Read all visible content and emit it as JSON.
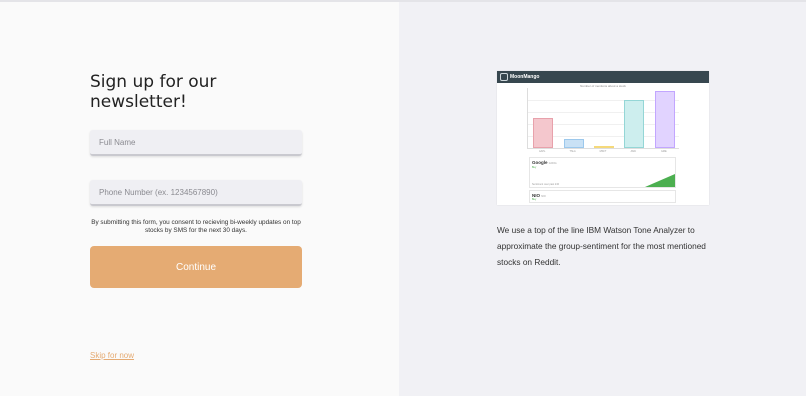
{
  "signup": {
    "title": "Sign up for our newsletter!",
    "full_name_placeholder": "Full Name",
    "phone_placeholder": "Phone Number (ex. 1234567890)",
    "consent": "By submitting this form, you consent to recieving bi-weekly updates on top stocks by SMS for the next 30 days.",
    "continue_label": "Continue",
    "skip_label": "Skip for now"
  },
  "preview": {
    "brand": "MoonMango",
    "chart_title": "Number of mentions about a stock",
    "bars": [
      {
        "label": "AAPL",
        "value": 50,
        "color": "#f4c7cd",
        "border": "#e8a1ab"
      },
      {
        "label": "TSLA",
        "value": 15,
        "color": "#c9e1f5",
        "border": "#9cc8ec"
      },
      {
        "label": "MSFT",
        "value": 2,
        "color": "#fff2c4",
        "border": "#f5d97a"
      },
      {
        "label": "AMC",
        "value": 80,
        "color": "#cdeeee",
        "border": "#94d6d6"
      },
      {
        "label": "GME",
        "value": 95,
        "color": "#e1d3ff",
        "border": "#c2a6ff"
      }
    ],
    "ymax": 100,
    "card1_name": "Google",
    "card1_ticker": "GOOG",
    "card1_sentiment": "Buy",
    "card1_footer": "Sentiment over past 24h",
    "card2_name": "NIO",
    "card2_ticker": "NIO",
    "card2_sentiment": "Buy",
    "green": "#4caf50"
  },
  "description": "We use a top of the line IBM Watson Tone Analyzer to approximate the group-sentiment for the most mentioned stocks on Reddit.",
  "colors": {
    "accent": "#e5ab73",
    "right_panel": "#f1f1f5",
    "left_panel": "#fafafa"
  }
}
